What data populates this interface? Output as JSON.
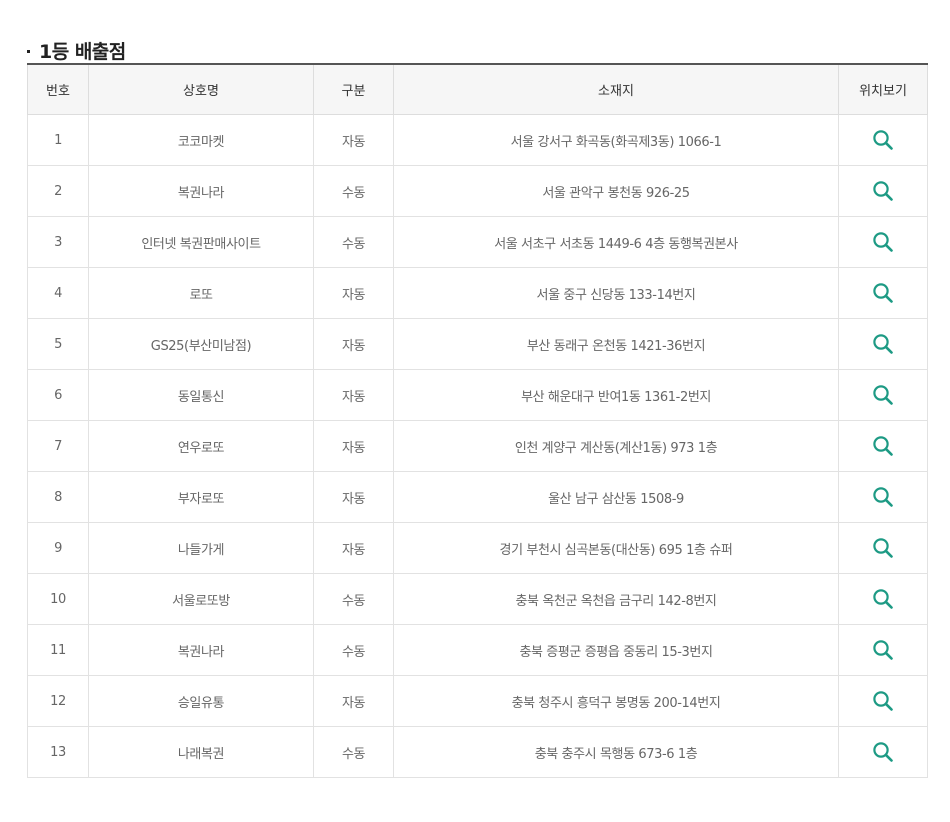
{
  "section": {
    "title": "1등 배출점"
  },
  "table": {
    "headers": {
      "num": "번호",
      "name": "상호명",
      "type": "구분",
      "address": "소재지",
      "map": "위치보기"
    },
    "rows": [
      {
        "num": "1",
        "name": "코코마켓",
        "type": "자동",
        "address": "서울 강서구 화곡동(화곡제3동) 1066-1"
      },
      {
        "num": "2",
        "name": "복권나라",
        "type": "수동",
        "address": "서울 관악구 봉천동 926-25"
      },
      {
        "num": "3",
        "name": "인터넷 복권판매사이트",
        "type": "수동",
        "address": "서울 서초구 서초동 1449-6 4층 동행복권본사"
      },
      {
        "num": "4",
        "name": "로또",
        "type": "자동",
        "address": "서울 중구 신당동 133-14번지"
      },
      {
        "num": "5",
        "name": "GS25(부산미남점)",
        "type": "자동",
        "address": "부산 동래구 온천동 1421-36번지"
      },
      {
        "num": "6",
        "name": "동일통신",
        "type": "자동",
        "address": "부산 해운대구 반여1동 1361-2번지"
      },
      {
        "num": "7",
        "name": "연우로또",
        "type": "자동",
        "address": "인천 계양구 계산동(계산1동) 973 1층"
      },
      {
        "num": "8",
        "name": "부자로또",
        "type": "자동",
        "address": "울산 남구 삼산동 1508-9"
      },
      {
        "num": "9",
        "name": "나들가게",
        "type": "자동",
        "address": "경기 부천시 심곡본동(대산동) 695 1층 슈퍼"
      },
      {
        "num": "10",
        "name": "서울로또방",
        "type": "수동",
        "address": "충북 옥천군 옥천읍 금구리 142-8번지"
      },
      {
        "num": "11",
        "name": "복권나라",
        "type": "수동",
        "address": "충북 증평군 증평읍 중동리 15-3번지"
      },
      {
        "num": "12",
        "name": "승일유통",
        "type": "자동",
        "address": "충북 청주시 흥덕구 봉명동 200-14번지"
      },
      {
        "num": "13",
        "name": "나래복권",
        "type": "수동",
        "address": "충북 충주시 목행동 673-6 1층"
      }
    ]
  },
  "icons": {
    "map_view": "search-icon"
  },
  "colors": {
    "icon_accent": "#1d9a84",
    "header_bg": "#f6f6f6",
    "top_border": "#555555"
  }
}
